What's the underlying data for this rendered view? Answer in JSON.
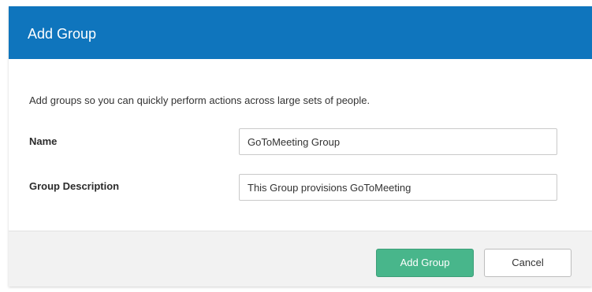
{
  "dialog": {
    "title": "Add Group",
    "intro": "Add groups so you can quickly perform actions across large sets of people.",
    "fields": {
      "name": {
        "label": "Name",
        "value": "GoToMeeting Group"
      },
      "description": {
        "label": "Group Description",
        "value": "This Group provisions GoToMeeting"
      }
    },
    "buttons": {
      "submit": "Add Group",
      "cancel": "Cancel"
    }
  },
  "colors": {
    "header": "#0f75bd",
    "primary_button": "#48b68b",
    "footer": "#f2f2f2"
  }
}
